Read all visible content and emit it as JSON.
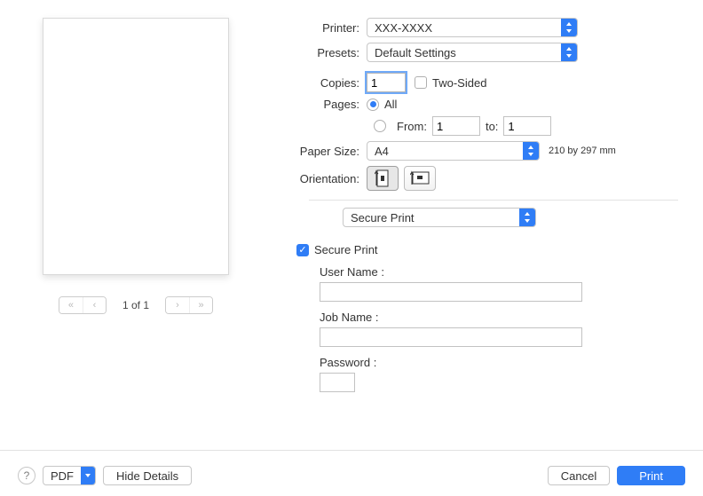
{
  "labels": {
    "printer": "Printer:",
    "presets": "Presets:",
    "copies": "Copies:",
    "twoSided": "Two-Sided",
    "pages": "Pages:",
    "all": "All",
    "from": "From:",
    "to": "to:",
    "paperSize": "Paper Size:",
    "orientation": "Orientation:",
    "securePrint": "Secure Print",
    "securePrintCheck": "Secure Print",
    "userName": "User Name :",
    "jobName": "Job Name :",
    "password": "Password :"
  },
  "values": {
    "printer": "XXX-XXXX",
    "presets": "Default Settings",
    "copies": "1",
    "pagesFrom": "1",
    "pagesTo": "1",
    "paperSize": "A4",
    "paperDim": "210 by 297 mm",
    "userName": "",
    "jobName": "",
    "password": ""
  },
  "pager": {
    "text": "1 of 1"
  },
  "footer": {
    "pdf": "PDF",
    "hideDetails": "Hide Details",
    "cancel": "Cancel",
    "print": "Print"
  }
}
